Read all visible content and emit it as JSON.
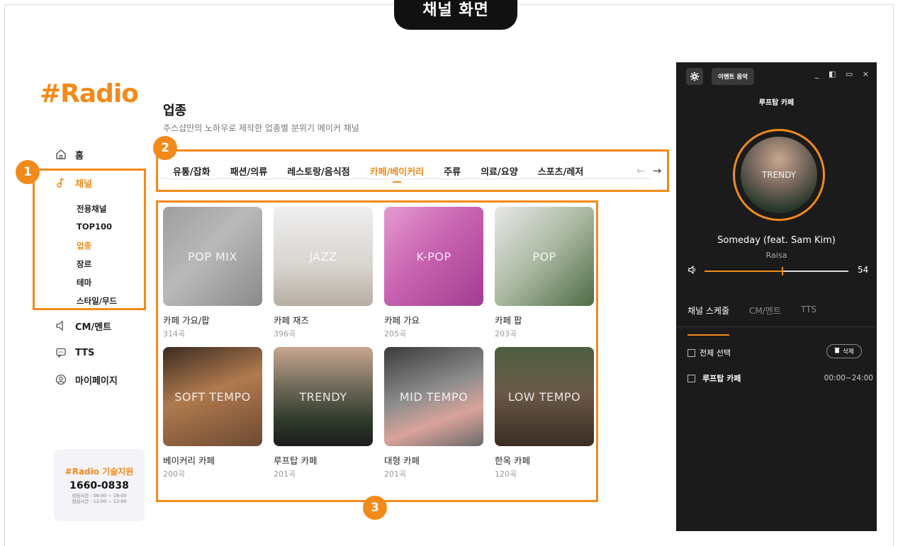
{
  "header": {
    "title": "채널 화면"
  },
  "sidebar": {
    "logo": "#Radio",
    "items": [
      {
        "label": "홈",
        "icon": "home-icon"
      },
      {
        "label": "채널",
        "icon": "music-note-icon"
      },
      {
        "label": "CM/멘트",
        "icon": "speaker-icon"
      },
      {
        "label": "TTS",
        "icon": "chat-bubble-icon"
      },
      {
        "label": "마이페이지",
        "icon": "user-icon"
      }
    ],
    "subitems": [
      "전용채널",
      "TOP100",
      "업종",
      "장르",
      "테마",
      "스타일/무드"
    ],
    "support": {
      "title": "#Radio 기술지원",
      "phone": "1660-0838",
      "hours1": "상담시간 : 09:00 ~ 18:00",
      "hours2": "점심시간 : 12:00 ~ 13:00"
    }
  },
  "badges": [
    "1",
    "2",
    "3"
  ],
  "main": {
    "title": "업종",
    "desc": "주스샵만의 노하우로 제작한 업종별 분위기 메이커 채널",
    "tabs": [
      "유통/잡화",
      "패션/의류",
      "레스토랑/음식점",
      "카페/베이커리",
      "주류",
      "의료/요양",
      "스포츠/레저"
    ],
    "arrows": [
      "←",
      "→"
    ],
    "cards": [
      {
        "thumb": "POP MIX",
        "name": "카페 가요/팝",
        "count": "314곡"
      },
      {
        "thumb": "JAZZ",
        "name": "카페 재즈",
        "count": "396곡"
      },
      {
        "thumb": "K-POP",
        "name": "카페 가요",
        "count": "205곡"
      },
      {
        "thumb": "POP",
        "name": "카페 팝",
        "count": "203곡"
      },
      {
        "thumb": "SOFT TEMPO",
        "name": "베이커리 카페",
        "count": "200곡"
      },
      {
        "thumb": "TRENDY",
        "name": "루프탑 카페",
        "count": "201곡"
      },
      {
        "thumb": "MID TEMPO",
        "name": "대형 카페",
        "count": "201곡"
      },
      {
        "thumb": "LOW TEMPO",
        "name": "한옥 카페",
        "count": "120곡"
      }
    ]
  },
  "player": {
    "event_label": "이벤트 음악",
    "window_controls": "_ ◧ ▭ ×",
    "channel": "루프탑 카페",
    "disc_label": "TRENDY",
    "song": "Someday (feat. Sam Kim)",
    "artist": "Raisa",
    "volume": 54,
    "volume_label": "54",
    "tabs": [
      "채널 스케줄",
      "CM/멘트",
      "TTS"
    ],
    "select_all": "전체 선택",
    "delete_label": "삭제",
    "schedule": [
      {
        "name": "루프탑 카페",
        "time": "00:00~24:00"
      }
    ]
  },
  "colors": {
    "accent": "#f28a1a",
    "player_bg": "#1b1b1b"
  }
}
